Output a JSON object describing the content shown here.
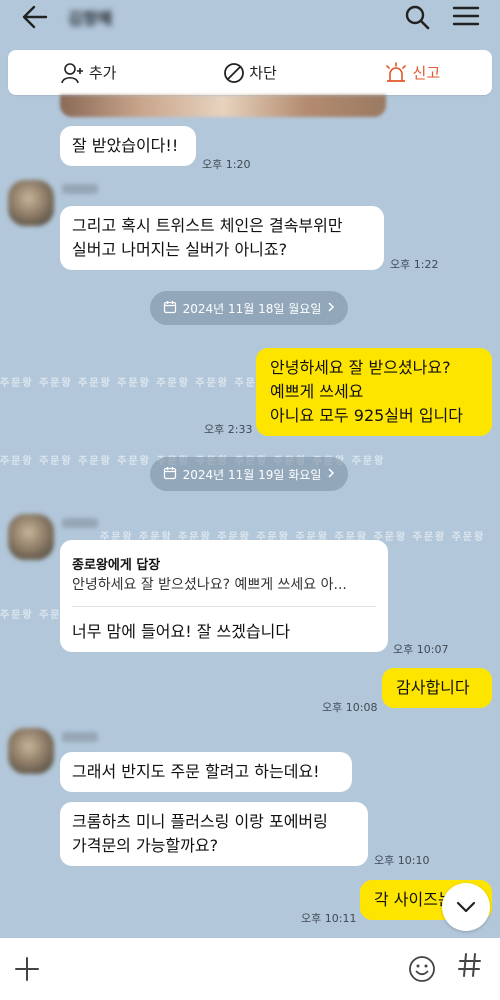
{
  "header": {
    "title": "김향혜",
    "back_icon": "back-arrow-icon",
    "search_icon": "search-icon",
    "menu_icon": "hamburger-menu-icon"
  },
  "actions": {
    "add_label": "추가",
    "block_label": "차단",
    "report_label": "신고",
    "report_color": "#e3572a"
  },
  "messages": {
    "m1_text": "잘 받았습이다!!",
    "m1_time": "오후 1:20",
    "m2_text": "그리고 혹시 트위스트 체인은 결속부위만\n실버고 나머지는 실버가 아니죠?",
    "m2_time": "오후 1:22",
    "date1": "2024년 11월 18일 월요일",
    "m3_text": "안녕하세요 잘 받으셨나요?\n예쁘게 쓰세요\n아니요 모두 925실버 입니다",
    "m3_time": "오후 2:33",
    "date2": "2024년 11월 19일 화요일",
    "reply_header": "종로왕에게 답장",
    "reply_quote": "안녕하세요 잘 받으셨나요? 예쁘게 쓰세요 아...",
    "reply_body": "너무 맘에 들어요! 잘 쓰겠습니다",
    "m4_time": "오후 10:07",
    "m5_text": "감사합니다",
    "m5_time": "오후 10:08",
    "m6_text": "그래서 반지도 주문 할려고 하는데요!",
    "m7_text": "크롬하츠 미니 플러스링 이랑 포에버링\n가격문의 가능할까요?",
    "m7_time": "오후 10:10",
    "m8_text": "각 사이즈는",
    "m8_time": "오후 10:11"
  },
  "watermark_text": "주문왕 주문왕 주문왕 주문왕 주문왕 주문왕 주문왕 주문왕 주문왕 주문왕",
  "colors": {
    "background": "#b2c7da",
    "my_bubble": "#fee500",
    "other_bubble": "#ffffff"
  }
}
